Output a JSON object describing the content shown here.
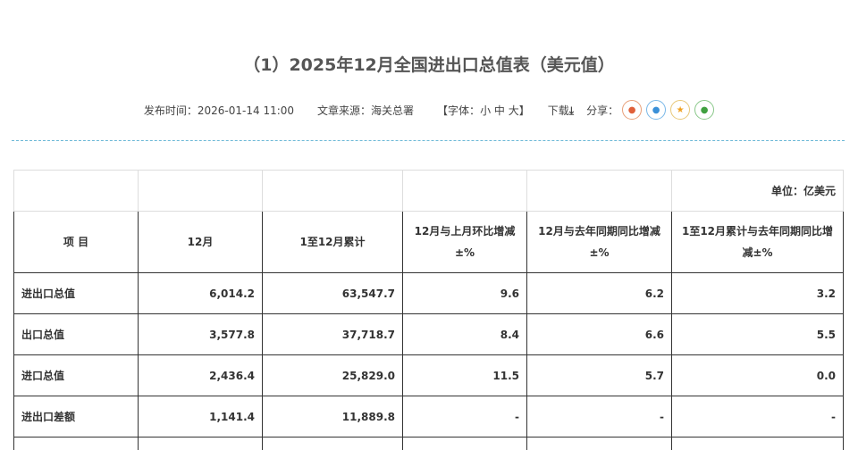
{
  "title": "（1）2025年12月全国进出口总值表（美元值）",
  "meta": {
    "publish": "发布时间：2026-01-14 11:00",
    "source": "文章来源：海关总署",
    "font_label": "【字体：",
    "font_small": "小",
    "font_mid": "中",
    "font_large": "大】",
    "download": "下载",
    "share": "分享："
  },
  "unit": "单位：亿美元",
  "headers": [
    "项 目",
    "12月",
    "1至12月累计",
    "12月与上月环比增减±%",
    "12月与去年同期同比增减±%",
    "1至12月累计与去年同期同比增减±%"
  ],
  "rows": [
    [
      "进出口总值",
      "6,014.2",
      "63,547.7",
      "9.6",
      "6.2",
      "3.2"
    ],
    [
      "出口总值",
      "3,577.8",
      "37,718.7",
      "8.4",
      "6.6",
      "5.5"
    ],
    [
      "进口总值",
      "2,436.4",
      "25,829.0",
      "11.5",
      "5.7",
      "0.0"
    ],
    [
      "进出口差额",
      "1,141.4",
      "11,889.8",
      "-",
      "-",
      "-"
    ]
  ]
}
